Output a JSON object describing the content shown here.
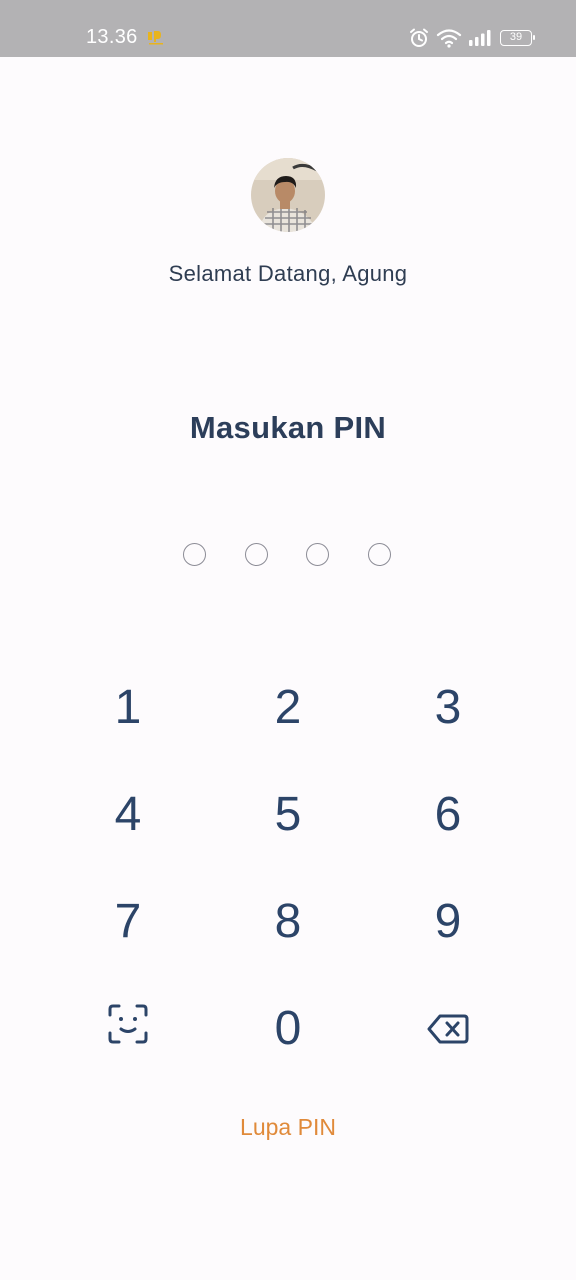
{
  "status_bar": {
    "time": "13.36",
    "battery_level": "39",
    "icons": [
      "app-notification-icon",
      "alarm-icon",
      "wifi-icon",
      "signal-icon",
      "battery-icon"
    ]
  },
  "profile": {
    "greeting": "Selamat Datang, Agung"
  },
  "pin": {
    "title": "Masukan PIN",
    "length": 4,
    "entered": 0
  },
  "keypad": {
    "keys": [
      "1",
      "2",
      "3",
      "4",
      "5",
      "6",
      "7",
      "8",
      "9",
      "0"
    ],
    "face_id_icon": "face-scan-icon",
    "backspace_icon": "backspace-icon"
  },
  "forgot_pin_label": "Lupa PIN",
  "colors": {
    "status_bar": "#b3b2b4",
    "background": "#fdfbfd",
    "text_primary": "#2c3e5a",
    "keypad_digit": "#2c4468",
    "accent": "#e08a3a",
    "pin_dot_border": "#8c8c96"
  }
}
